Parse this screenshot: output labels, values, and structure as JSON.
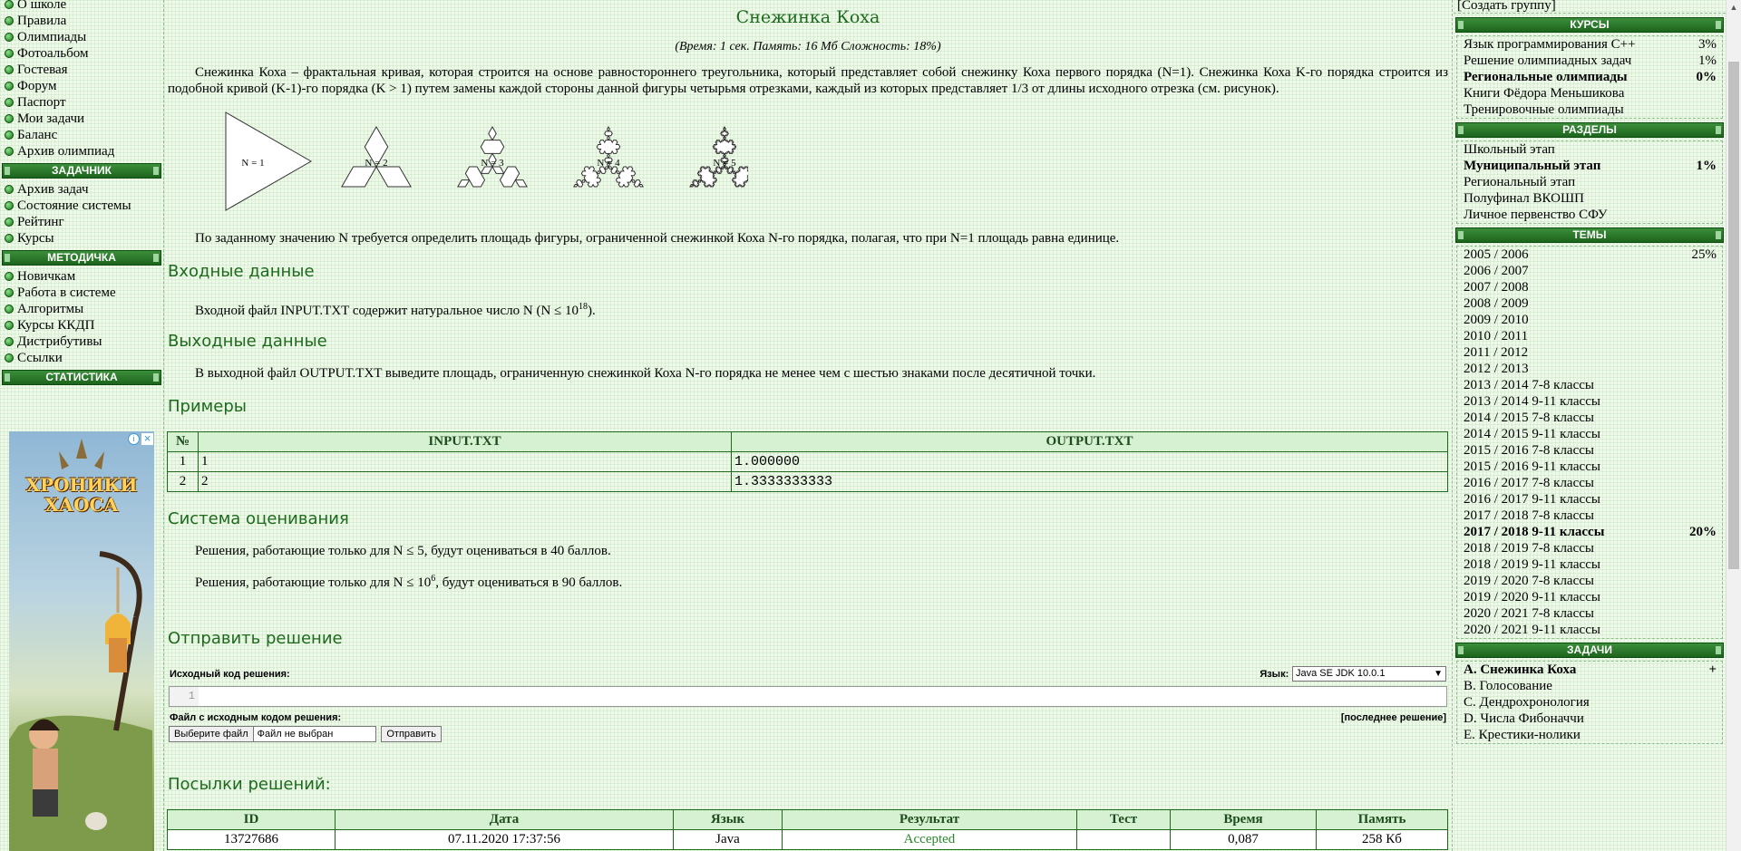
{
  "left": {
    "top_items": [
      "О школе",
      "Правила",
      "Олимпиады",
      "Фотоальбом",
      "Гостевая",
      "Форум",
      "Паспорт",
      "Мои задачи",
      "Баланс",
      "Архив олимпиад"
    ],
    "zadachnik_title": "ЗАДАЧНИК",
    "zadachnik_items": [
      "Архив задач",
      "Состояние системы",
      "Рейтинг",
      "Курсы"
    ],
    "metod_title": "МЕТОДИЧКА",
    "metod_items": [
      "Новичкам",
      "Работа в системе",
      "Алгоритмы",
      "Курсы ККДП",
      "Дистрибутивы",
      "Ссылки"
    ],
    "stat_title": "СТАТИСТИКА",
    "ad_title_1": "ХРОНИКИ",
    "ad_title_2": "ХАОСА"
  },
  "problem": {
    "title": "Снежинка Коха",
    "limits": "(Время: 1 сек. Память: 16 Мб Сложность: 18%)",
    "statement": "Снежинка Коха – фрактальная кривая, которая строится на основе равностороннего треугольника, который представляет собой снежинку Коха первого порядка (N=1). Снежинка Коха K-го порядка строится из подобной кривой (K-1)-го порядка (K > 1) путем замены каждой стороны данной фигуры четырьмя отрезками, каждый из которых представляет 1/3 от длины исходного отрезка (см. рисунок).",
    "figure_labels": [
      "N = 1",
      "N = 2",
      "N = 3",
      "N = 4",
      "N = 5"
    ],
    "task": "По заданному значению N требуется определить площадь фигуры, ограниченной снежинкой Коха N-го порядка, полагая, что при N=1 площадь равна единице.",
    "input_title": "Входные данные",
    "input_text": "Входной файл INPUT.TXT содержит натуральное число N (N ≤ 10",
    "input_sup": "18",
    "input_end": ").",
    "output_title": "Выходные данные",
    "output_text": "В выходной файл OUTPUT.TXT выведите площадь, ограниченную снежинкой Коха N-го порядка не менее чем с шестью знаками после десятичной точки.",
    "examples_title": "Примеры",
    "examples_head": [
      "№",
      "INPUT.TXT",
      "OUTPUT.TXT"
    ],
    "examples": [
      [
        "1",
        "1",
        "1.000000"
      ],
      [
        "2",
        "2",
        "1.3333333333"
      ]
    ],
    "scoring_title": "Система оценивания",
    "scoring_1": "Решения, работающие только для N ≤ 5, будут оцениваться в 40 баллов.",
    "scoring_2a": "Решения, работающие только для N ≤ 10",
    "scoring_2sup": "6",
    "scoring_2b": ", будут оцениваться в 90 баллов."
  },
  "submit": {
    "title": "Отправить решение",
    "code_label": "Исходный код решения:",
    "lang_label": "Язык:",
    "lang_value": "Java SE JDK 10.0.1",
    "line_no": "1",
    "file_label": "Файл с исходным кодом решения:",
    "last_solution": "[последнее решение]",
    "choose_file": "Выберите файл",
    "no_file": "Файл не выбран",
    "send": "Отправить"
  },
  "submissions": {
    "title": "Посылки решений:",
    "headers": [
      "ID",
      "Дата",
      "Язык",
      "Результат",
      "Тест",
      "Время",
      "Память"
    ],
    "rows": [
      [
        "13727686",
        "07.11.2020 17:37:56",
        "Java",
        "Accepted",
        "",
        "0,087",
        "258 Кб"
      ]
    ]
  },
  "right": {
    "create_group": "[Создать группу]",
    "courses_title": "КУРСЫ",
    "courses": [
      {
        "label": "Язык программирования C++",
        "pct": "3%",
        "bold": false
      },
      {
        "label": "Решение олимпиадных задач",
        "pct": "1%",
        "bold": false
      },
      {
        "label": "Региональные олимпиады",
        "pct": "0%",
        "bold": true
      },
      {
        "label": "Книги Фёдора Меньшикова",
        "pct": "",
        "bold": false
      },
      {
        "label": "Тренировочные олимпиады",
        "pct": "",
        "bold": false
      }
    ],
    "sections_title": "РАЗДЕЛЫ",
    "sections": [
      {
        "label": "Школьный этап",
        "pct": "",
        "bold": false
      },
      {
        "label": "Муниципальный этап",
        "pct": "1%",
        "bold": true
      },
      {
        "label": "Региональный этап",
        "pct": "",
        "bold": false
      },
      {
        "label": "Полуфинал ВКОШП",
        "pct": "",
        "bold": false
      },
      {
        "label": "Личное первенство СФУ",
        "pct": "",
        "bold": false
      }
    ],
    "themes_title": "ТЕМЫ",
    "themes": [
      {
        "label": "2005 / 2006",
        "pct": "25%",
        "bold": false
      },
      {
        "label": "2006 / 2007",
        "pct": "",
        "bold": false
      },
      {
        "label": "2007 / 2008",
        "pct": "",
        "bold": false
      },
      {
        "label": "2008 / 2009",
        "pct": "",
        "bold": false
      },
      {
        "label": "2009 / 2010",
        "pct": "",
        "bold": false
      },
      {
        "label": "2010 / 2011",
        "pct": "",
        "bold": false
      },
      {
        "label": "2011 / 2012",
        "pct": "",
        "bold": false
      },
      {
        "label": "2012 / 2013",
        "pct": "",
        "bold": false
      },
      {
        "label": "2013 / 2014 7-8 классы",
        "pct": "",
        "bold": false
      },
      {
        "label": "2013 / 2014 9-11 классы",
        "pct": "",
        "bold": false
      },
      {
        "label": "2014 / 2015 7-8 классы",
        "pct": "",
        "bold": false
      },
      {
        "label": "2014 / 2015 9-11 классы",
        "pct": "",
        "bold": false
      },
      {
        "label": "2015 / 2016 7-8 классы",
        "pct": "",
        "bold": false
      },
      {
        "label": "2015 / 2016 9-11 классы",
        "pct": "",
        "bold": false
      },
      {
        "label": "2016 / 2017 7-8 классы",
        "pct": "",
        "bold": false
      },
      {
        "label": "2016 / 2017 9-11 классы",
        "pct": "",
        "bold": false
      },
      {
        "label": "2017 / 2018 7-8 классы",
        "pct": "",
        "bold": false
      },
      {
        "label": "2017 / 2018 9-11 классы",
        "pct": "20%",
        "bold": true
      },
      {
        "label": "2018 / 2019 7-8 классы",
        "pct": "",
        "bold": false
      },
      {
        "label": "2018 / 2019 9-11 классы",
        "pct": "",
        "bold": false
      },
      {
        "label": "2019 / 2020 7-8 классы",
        "pct": "",
        "bold": false
      },
      {
        "label": "2019 / 2020 9-11 классы",
        "pct": "",
        "bold": false
      },
      {
        "label": "2020 / 2021 7-8 классы",
        "pct": "",
        "bold": false
      },
      {
        "label": "2020 / 2021 9-11 классы",
        "pct": "",
        "bold": false
      }
    ],
    "tasks_title": "ЗАДАЧИ",
    "tasks": [
      {
        "label": "A. Снежинка Коха",
        "pct": "+",
        "bold": true
      },
      {
        "label": "B. Голосование",
        "pct": "",
        "bold": false
      },
      {
        "label": "C. Дендрохронология",
        "pct": "",
        "bold": false
      },
      {
        "label": "D. Числа Фибоначчи",
        "pct": "",
        "bold": false
      },
      {
        "label": "E. Крестики-нолики",
        "pct": "",
        "bold": false
      }
    ]
  },
  "colors": {
    "accent_green": "#1d6a1d",
    "accepted": "#2a8a2a",
    "panel_bg": "#eef9ea"
  }
}
